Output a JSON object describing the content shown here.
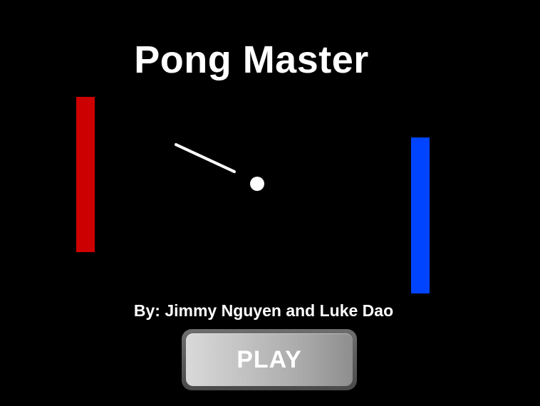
{
  "game": {
    "title": "Pong Master",
    "credits": "By: Jimmy Nguyen and Luke Dao",
    "play_label": "PLAY"
  },
  "colors": {
    "background": "#000000",
    "left_paddle": "#cc0000",
    "right_paddle": "#0044ff",
    "ball": "#ffffff",
    "trail": "#ffffff",
    "text": "#ffffff"
  },
  "icons": {
    "ball": "ball-icon",
    "trail": "ball-trail"
  }
}
